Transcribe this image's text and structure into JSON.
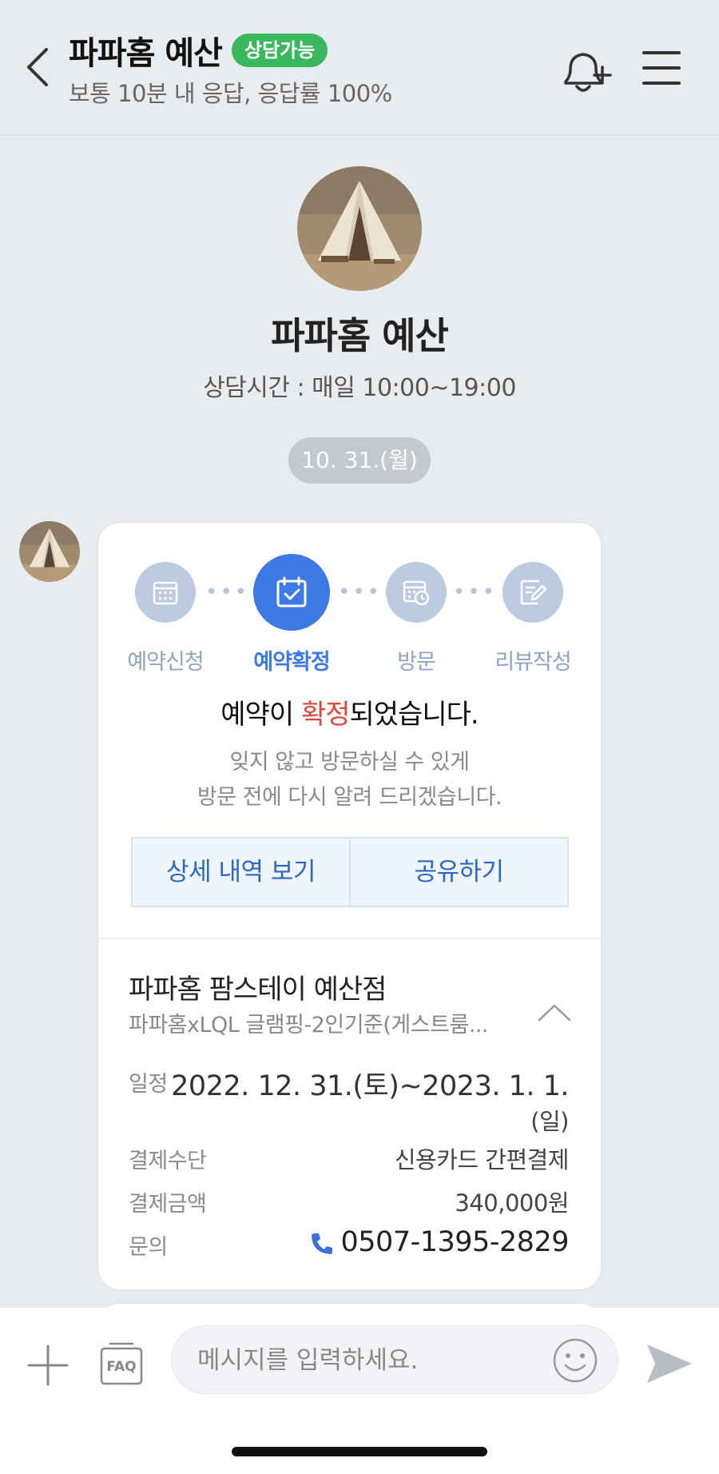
{
  "header": {
    "title": "파파홈 예산",
    "status_badge": "상담가능",
    "subtitle": "보통 10분 내 응답, 응답률 100%"
  },
  "profile": {
    "name": "파파홈 예산",
    "hours": "상담시간 : 매일 10:00~19:00"
  },
  "date_separator": "10. 31.(월)",
  "reservation_card": {
    "steps": [
      {
        "label": "예약신청",
        "icon": "calendar-grid-icon",
        "active": false
      },
      {
        "label": "예약확정",
        "icon": "calendar-check-icon",
        "active": true
      },
      {
        "label": "방문",
        "icon": "calendar-clock-icon",
        "active": false
      },
      {
        "label": "리뷰작성",
        "icon": "edit-note-icon",
        "active": false
      }
    ],
    "title_before": "예약이 ",
    "title_highlight": "확정",
    "title_after": "되었습니다.",
    "desc_line1": "잊지 않고 방문하실 수 있게",
    "desc_line2": "방문 전에 다시 알려 드리겠습니다.",
    "detail_button": "상세 내역 보기",
    "share_button": "공유하기",
    "shop_name": "파파홈 팜스테이 예산점",
    "product_name": "파파홈xLQL 글램핑-2인기준(게스트룸...",
    "rows": {
      "schedule_label": "일정",
      "schedule_value_line1": "2022. 12. 31.(토)~2023. 1. 1.",
      "schedule_value_line2": "(일)",
      "payment_method_label": "결제수단",
      "payment_method_value": "신용카드 간편결제",
      "payment_amount_label": "결제금액",
      "payment_amount_value": "340,000원",
      "inquiry_label": "문의",
      "inquiry_phone": "0507-1395-2829"
    }
  },
  "input_bar": {
    "placeholder": "메시지를 입력하세요.",
    "faq_label": "FAQ"
  },
  "colors": {
    "accent_blue": "#3d7ae5",
    "badge_green": "#3ab75f",
    "highlight_red": "#e0463a"
  }
}
